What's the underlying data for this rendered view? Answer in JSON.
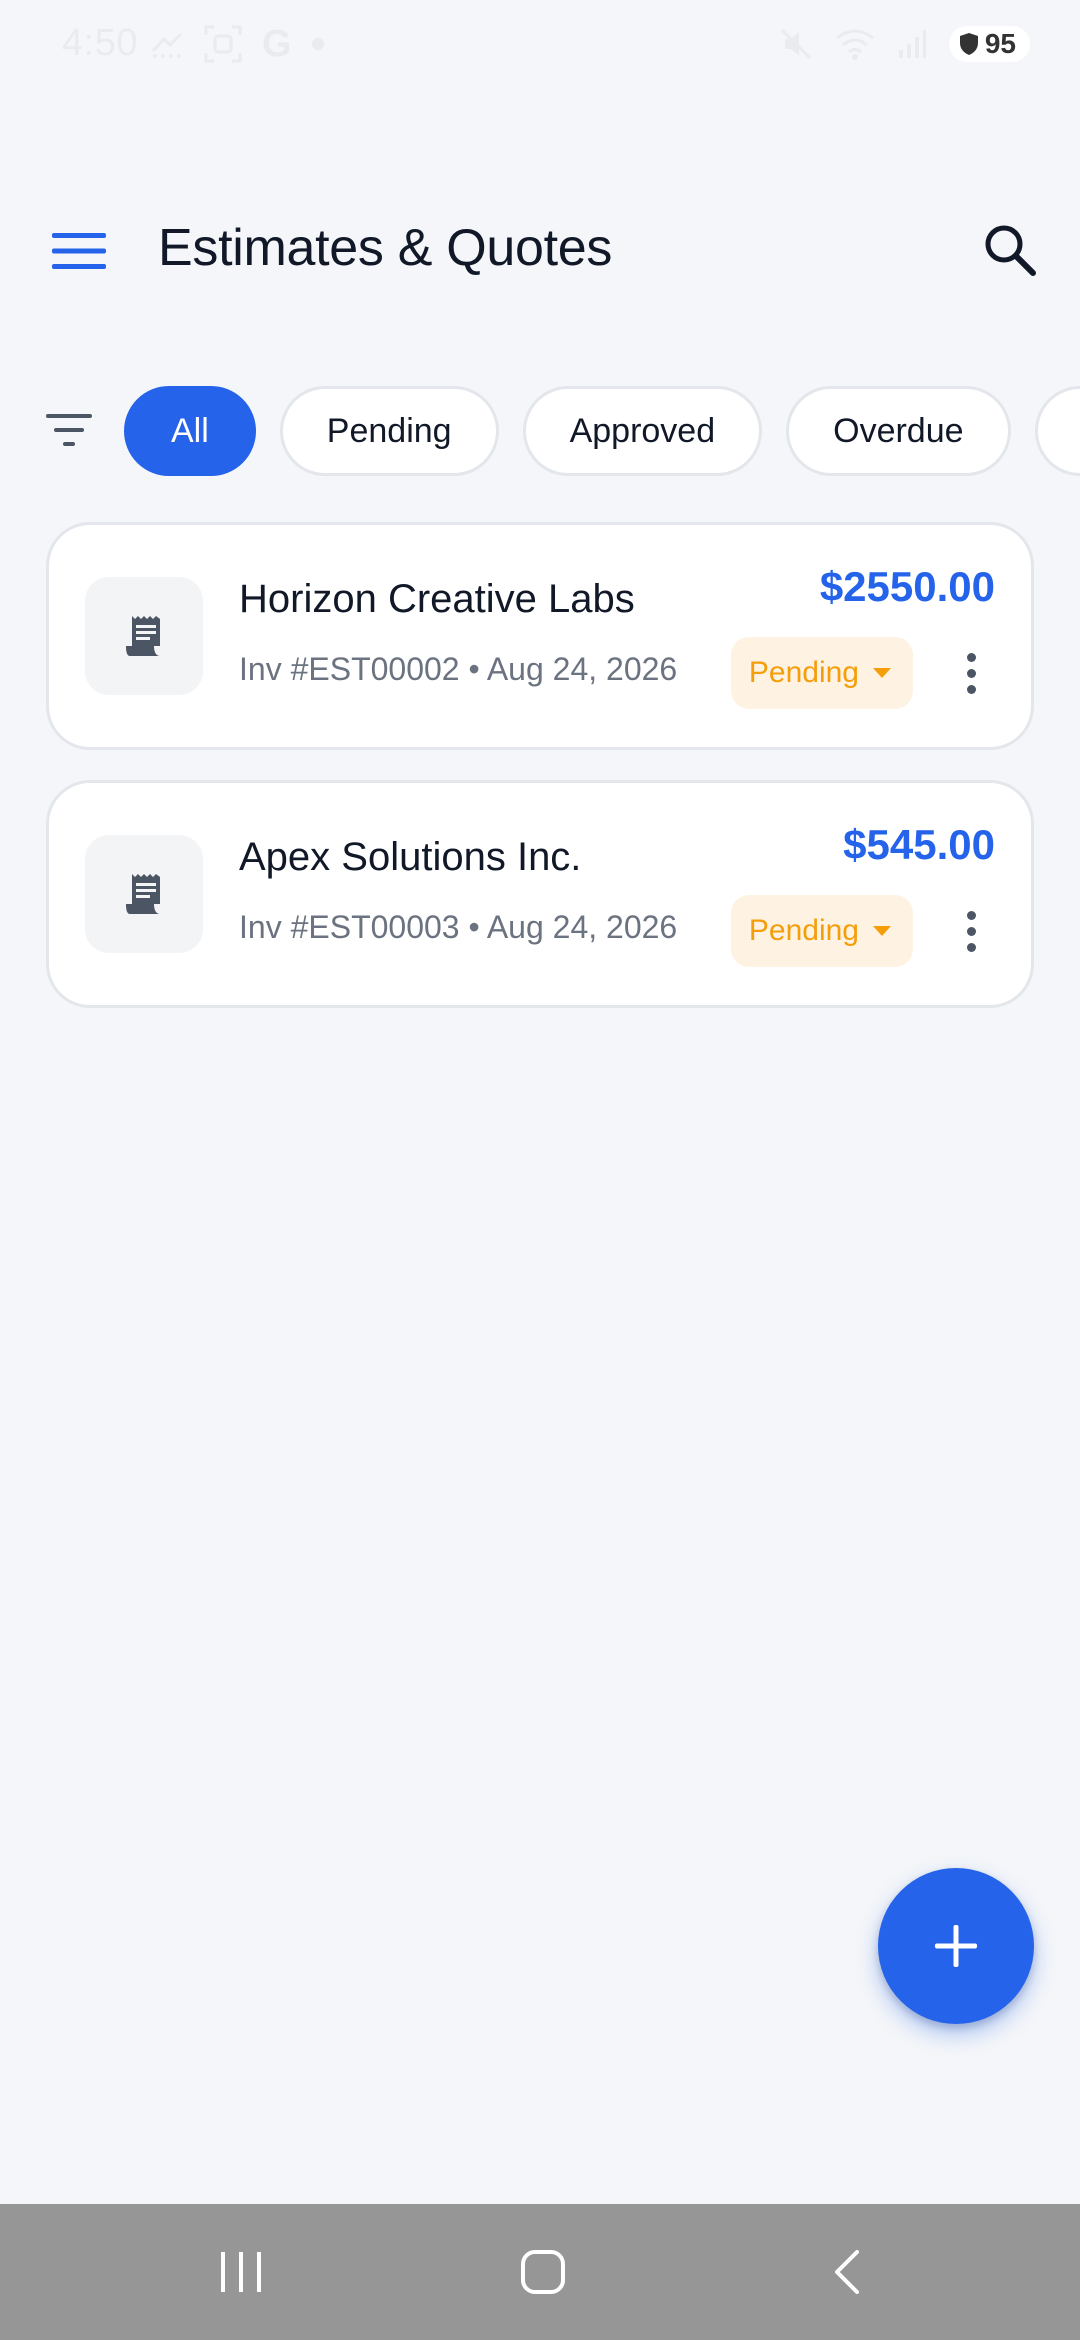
{
  "status_bar": {
    "time": "4:50",
    "left_icons": [
      "missed-call-icon",
      "screenshot-icon",
      "google-icon",
      "dot-icon"
    ],
    "right_icons": [
      "mute-icon",
      "wifi-icon",
      "signal-icon"
    ],
    "battery": "95",
    "google_letter": "G"
  },
  "app_bar": {
    "title": "Estimates & Quotes",
    "menu_icon": "hamburger-menu-icon",
    "search_icon": "search-icon"
  },
  "filters": {
    "icon": "filter-icon",
    "chips": [
      {
        "label": "All",
        "active": true
      },
      {
        "label": "Pending",
        "active": false
      },
      {
        "label": "Approved",
        "active": false
      },
      {
        "label": "Overdue",
        "active": false
      },
      {
        "label": "",
        "active": false
      }
    ]
  },
  "estimates": [
    {
      "client": "Horizon Creative Labs",
      "meta": "Inv #EST00002 • Aug 24, 2026",
      "amount": "$2550.00",
      "status": "Pending"
    },
    {
      "client": "Apex Solutions Inc.",
      "meta": "Inv #EST00003 • Aug 24, 2026",
      "amount": "$545.00",
      "status": "Pending"
    }
  ],
  "fab": {
    "icon": "plus-icon"
  },
  "colors": {
    "accent": "#2563eb",
    "pending_text": "#f59e0b",
    "pending_bg": "#fef3e2",
    "background": "#f4f6f9",
    "nav_bar": "#969696"
  },
  "nav_bar": {
    "buttons": [
      "recent-apps-icon",
      "home-icon",
      "back-icon"
    ]
  }
}
